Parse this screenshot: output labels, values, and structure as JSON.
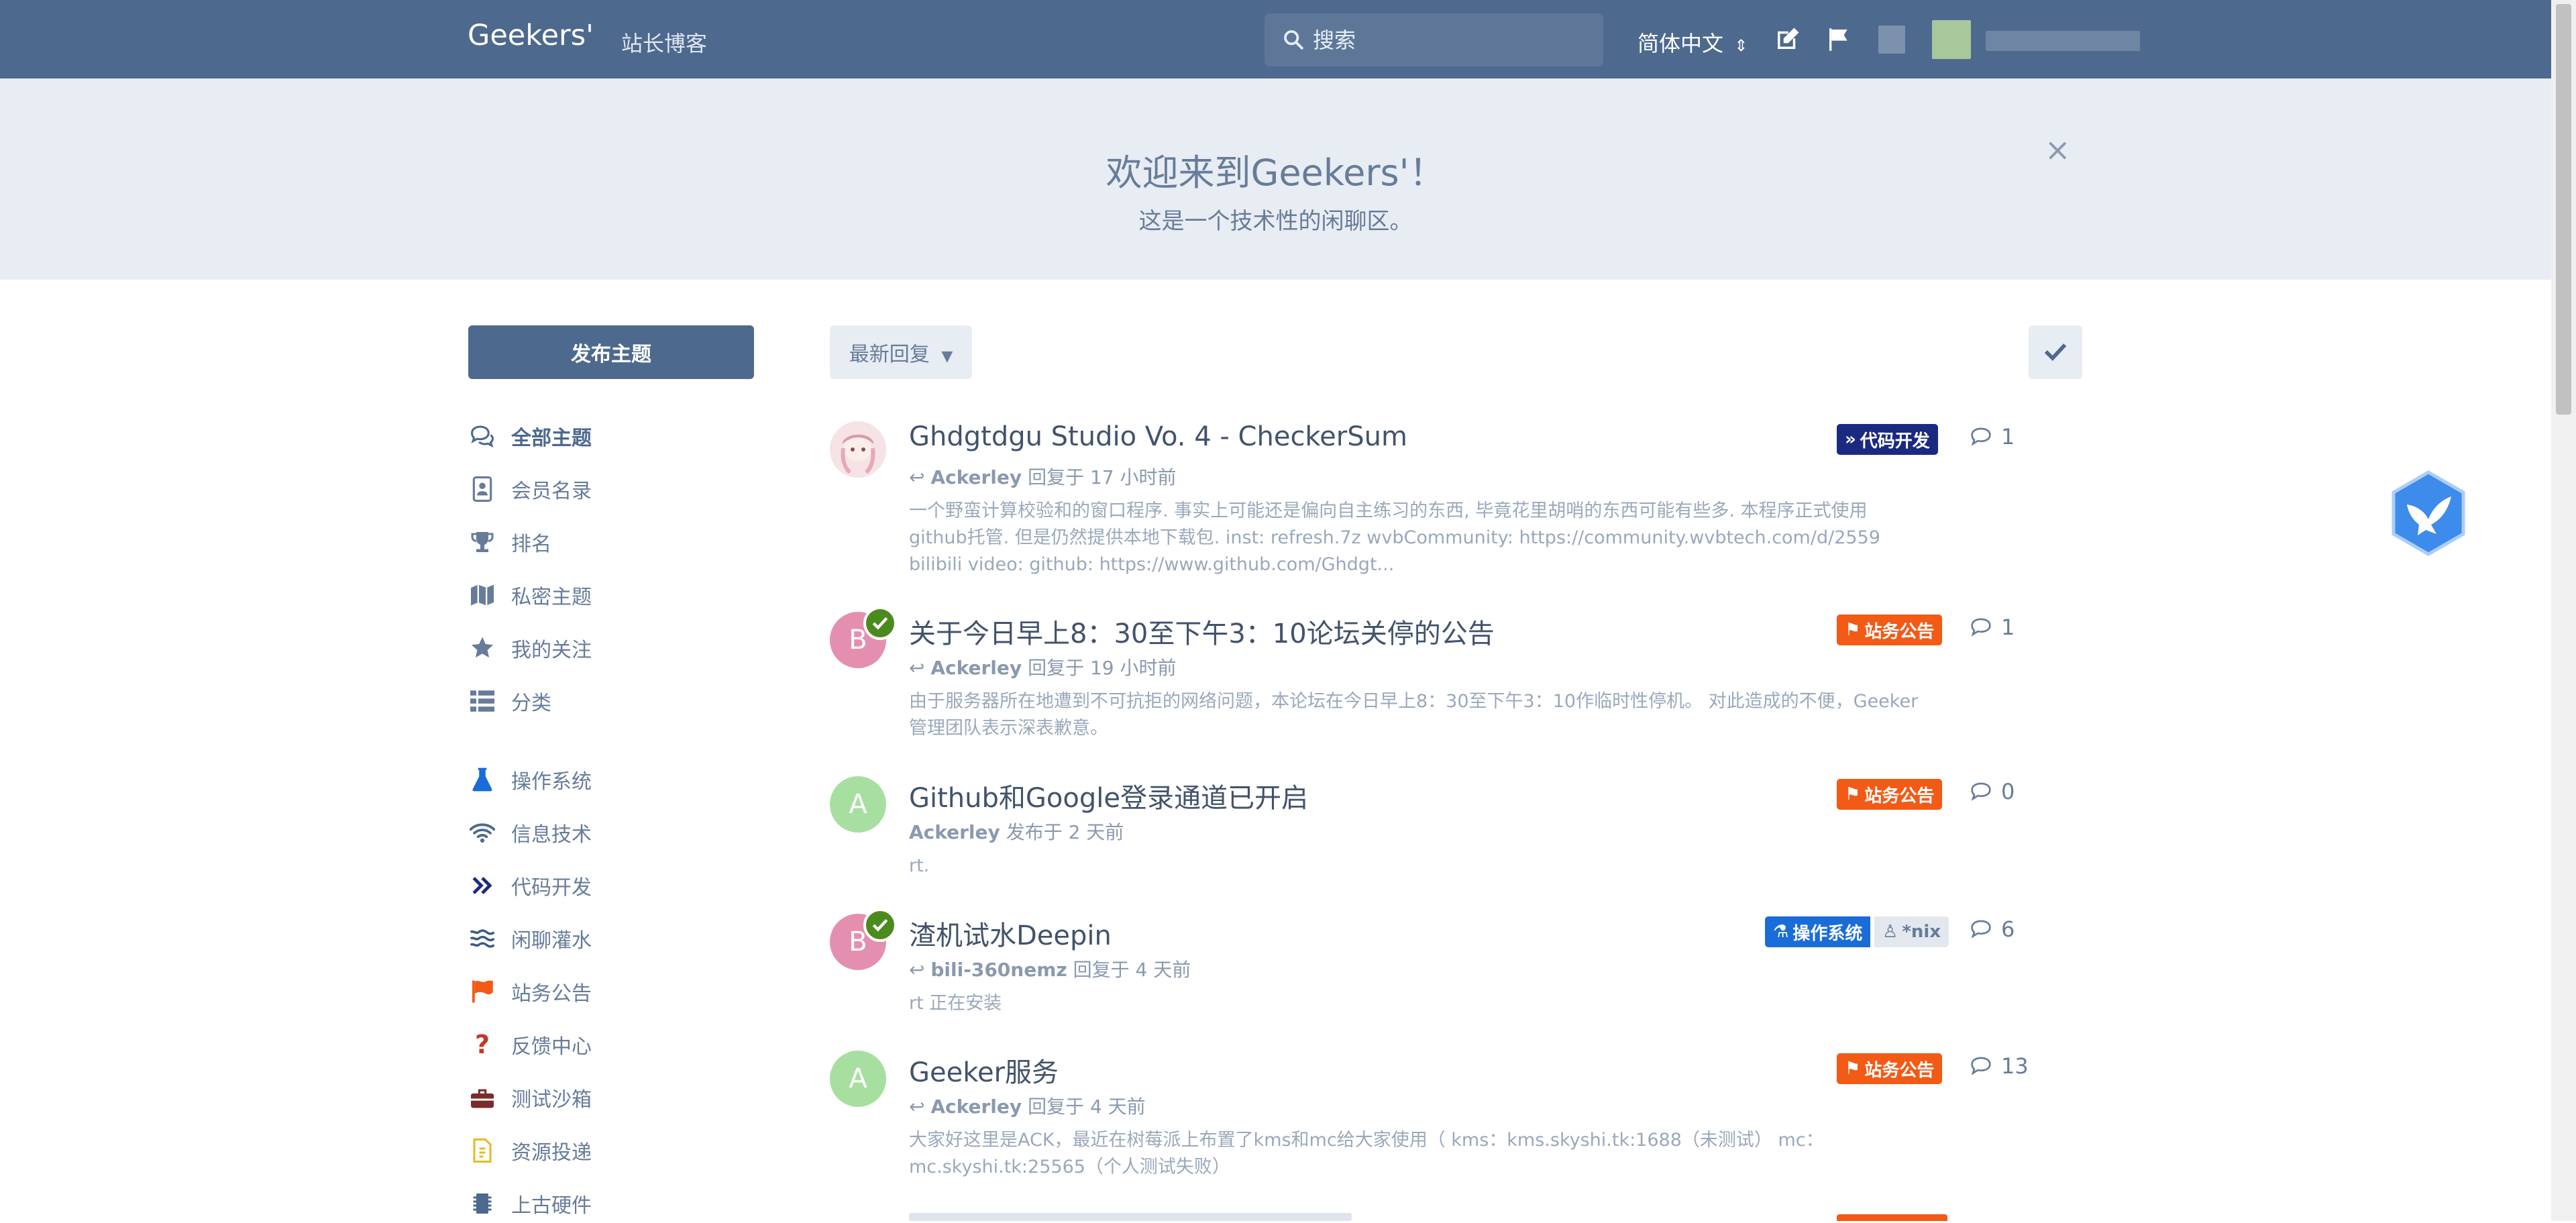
{
  "header": {
    "brand": "Geekers'",
    "blog_link": "站长博客",
    "search_placeholder": "搜索",
    "language": "简体中文"
  },
  "hero": {
    "title": "欢迎来到Geekers'！",
    "subtitle": "这是一个技术性的闲聊区。",
    "close": "×"
  },
  "sidebar": {
    "new_topic": "发布主题",
    "nav": [
      {
        "label": "全部主题",
        "icon": "comments-icon"
      },
      {
        "label": "会员名录",
        "icon": "address-book-icon"
      },
      {
        "label": "排名",
        "icon": "trophy-icon"
      },
      {
        "label": "私密主题",
        "icon": "map-icon"
      },
      {
        "label": "我的关注",
        "icon": "star-icon"
      },
      {
        "label": "分类",
        "icon": "list-icon"
      }
    ],
    "categories": [
      {
        "label": "操作系统",
        "icon": "flask-icon",
        "color": "#1a6cd8"
      },
      {
        "label": "信息技术",
        "icon": "wifi-icon",
        "color": "#4d698e"
      },
      {
        "label": "代码开发",
        "icon": "double-chevron-icon",
        "color": "#1b2a80"
      },
      {
        "label": "闲聊灌水",
        "icon": "water-icon",
        "color": "#3b5b85"
      },
      {
        "label": "站务公告",
        "icon": "flag-icon",
        "color": "#f25a16"
      },
      {
        "label": "反馈中心",
        "icon": "question-icon",
        "color": "#c0392b"
      },
      {
        "label": "测试沙箱",
        "icon": "toolbox-icon",
        "color": "#7a2b2b"
      },
      {
        "label": "资源投递",
        "icon": "file-icon",
        "color": "#e8b923"
      },
      {
        "label": "上古硬件",
        "icon": "chip-icon",
        "color": "#4d698e"
      }
    ]
  },
  "toolbar": {
    "sort_label": "最新回复"
  },
  "discussions": [
    {
      "title": "Ghdgtdgu Studio Vo. 4 - CheckerSum",
      "user": "Ackerley",
      "action": "回复于 17 小时前",
      "excerpt": "一个野蛮计算校验和的窗口程序. 事实上可能还是偏向自主练习的东西, 毕竟花里胡哨的东西可能有些多. 本程序正式使用github托管. 但是仍然提供本地下载包. inst: refresh.7z wvbCommunity: https://community.wvbtech.com/d/2559 bilibili video: github: https://www.github.com/Ghdgt...",
      "tags": [
        {
          "label": "代码开发",
          "color": "#1b2a80"
        }
      ],
      "replies": "1",
      "avatar_letter": "",
      "avatar_color": "#f3d9de"
    },
    {
      "title": "关于今日早上8：30至下午3：10论坛关停的公告",
      "user": "Ackerley",
      "action": "回复于 19 小时前",
      "excerpt": "由于服务器所在地遭到不可抗拒的网络问题，本论坛在今日早上8：30至下午3：10作临时性停机。 对此造成的不便，Geeker管理团队表示深表歉意。",
      "tags": [
        {
          "label": "站务公告",
          "color": "#f25a16"
        }
      ],
      "replies": "1",
      "avatar_letter": "B",
      "avatar_color": "#e58fb0"
    },
    {
      "title": "Github和Google登录通道已开启",
      "user": "Ackerley",
      "action": "发布于 2 天前",
      "excerpt": "rt.",
      "tags": [
        {
          "label": "站务公告",
          "color": "#f25a16"
        }
      ],
      "replies": "0",
      "avatar_letter": "A",
      "avatar_color": "#a7dfa0"
    },
    {
      "title": "渣机试水Deepin",
      "user": "bili-360nemz",
      "action": "回复于 4 天前",
      "excerpt": "rt 正在安装",
      "tags": [
        {
          "label": "操作系统",
          "color": "#1a6cd8"
        },
        {
          "label": "*nix",
          "color": "#e3e8ef"
        }
      ],
      "replies": "6",
      "avatar_letter": "B",
      "avatar_color": "#e58fb0"
    },
    {
      "title": "Geeker服务",
      "user": "Ackerley",
      "action": "回复于 4 天前",
      "excerpt": "大家好这里是ACK，最近在树莓派上布置了kms和mc给大家使用（ kms：kms.skyshi.tk:1688（未测试） mc：mc.skyshi.tk:25565（个人测试失败）",
      "tags": [
        {
          "label": "站务公告",
          "color": "#f25a16"
        }
      ],
      "replies": "13",
      "avatar_letter": "A",
      "avatar_color": "#a7dfa0"
    }
  ]
}
